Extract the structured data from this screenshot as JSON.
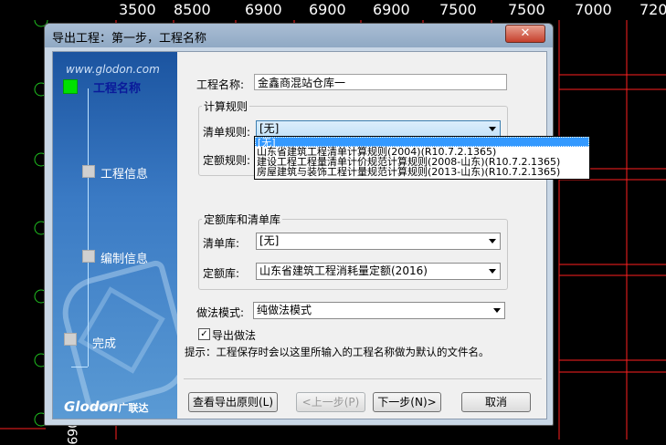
{
  "background": {
    "ruler_numbers": [
      "3500",
      "8500",
      "6900",
      "6900",
      "6900",
      "7500",
      "7500",
      "7000",
      "720"
    ],
    "vertical_text": "0069"
  },
  "dialog": {
    "title": "导出工程：第一步，工程名称",
    "close_label": "✕"
  },
  "wizard": {
    "website": "www.glodon.com",
    "steps": [
      {
        "label": "工程名称",
        "active": true
      },
      {
        "label": "工程信息",
        "active": false
      },
      {
        "label": "编制信息",
        "active": false
      },
      {
        "label": "完成",
        "active": false
      }
    ],
    "brand": "Glodon",
    "brand_cn": "广联达"
  },
  "form": {
    "project_name_label": "工程名称:",
    "project_name_value": "金鑫商混站仓库一",
    "calc_rules_group": "计算规则",
    "bill_rule_label": "清单规则:",
    "bill_rule_value": "[无]",
    "quota_rule_label": "定额规则:",
    "bill_rule_options": [
      "[无]",
      "山东省建筑工程清单计算规则(2004)(R10.7.2.1365)",
      "建设工程工程量清单计价规范计算规则(2008-山东)(R10.7.2.1365)",
      "房屋建筑与装饰工程计量规范计算规则(2013-山东)(R10.7.2.1365)"
    ],
    "library_group": "定额库和清单库",
    "bill_lib_label": "清单库:",
    "bill_lib_value": "[无]",
    "quota_lib_label": "定额库:",
    "quota_lib_value": "山东省建筑工程消耗量定额(2016)",
    "method_mode_label": "做法模式:",
    "method_mode_value": "纯做法模式",
    "export_method_label": "导出做法",
    "export_method_checked": true,
    "hint": "提示：工程保存时会以这里所输入的工程名称做为默认的文件名。"
  },
  "buttons": {
    "view_rules": "查看导出原则(L)",
    "prev": "<上一步(P)",
    "next": "下一步(N)>",
    "cancel": "取消"
  }
}
